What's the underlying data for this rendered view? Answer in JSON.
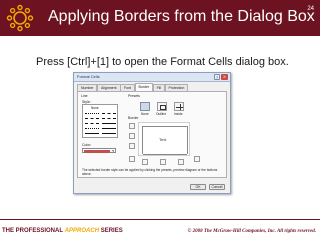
{
  "slide": {
    "title": "Applying Borders from the Dialog Box",
    "page_number": "24",
    "instruction": "Press [Ctrl]+[1] to open the Format Cells dialog box."
  },
  "dialog": {
    "title": "Format Cells",
    "close_label": "X",
    "help_label": "?",
    "tabs": [
      "Number",
      "Alignment",
      "Font",
      "Border",
      "Fill",
      "Protection"
    ],
    "active_tab": "Border",
    "line_section": "Line",
    "style_label": "Style:",
    "style_none": "None",
    "color_label": "Color:",
    "presets_label": "Presets",
    "preset_labels": [
      "None",
      "Outline",
      "Inside"
    ],
    "border_label": "Border",
    "preview_text": "Text",
    "note": "The selected border style can be applied by clicking the presets, preview diagram or the buttons above.",
    "ok_label": "OK",
    "cancel_label": "Cancel"
  },
  "footer": {
    "series_words": [
      "THE",
      "PROFESSIONAL",
      "APPROACH",
      "SERIES"
    ],
    "copyright": "© 2008 The McGraw-Hill Companies, Inc. All rights reserved."
  },
  "colors": {
    "brand_maroon": "#6d1221",
    "accent_gold": "#f2a900",
    "selected_border_color": "#c0504d"
  }
}
